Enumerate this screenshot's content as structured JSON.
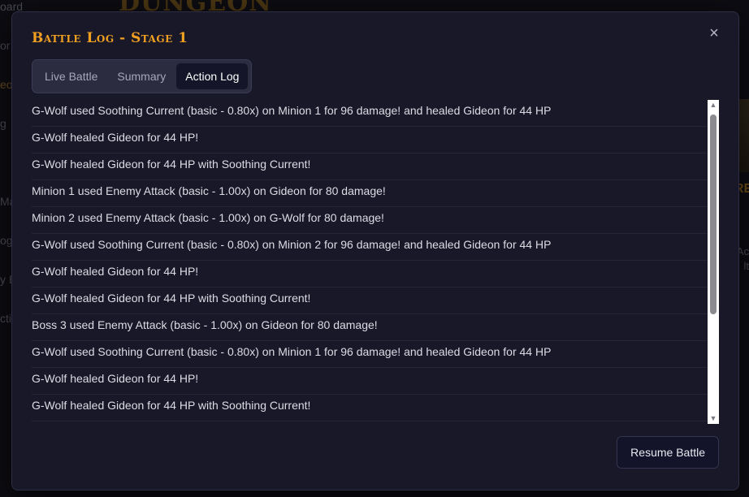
{
  "background": {
    "title": "DUNGEON",
    "sidebar_items": [
      "oard",
      "or",
      "eo",
      "g",
      "Ma",
      "og",
      "y B",
      "ctio"
    ],
    "right_texts": [
      "Ac",
      "lt"
    ],
    "right_accent": "RE"
  },
  "modal": {
    "title": "Battle Log - Stage 1",
    "close_symbol": "×",
    "tabs": [
      {
        "label": "Live Battle",
        "active": false
      },
      {
        "label": "Summary",
        "active": false
      },
      {
        "label": "Action Log",
        "active": true
      }
    ],
    "log_entries": [
      "G-Wolf used Soothing Current (basic - 0.80x) on Minion 1 for 96 damage! and healed Gideon for 44 HP",
      "G-Wolf healed Gideon for 44 HP!",
      "G-Wolf healed Gideon for 44 HP with Soothing Current!",
      "Minion 1 used Enemy Attack (basic - 1.00x) on Gideon for 80 damage!",
      "Minion 2 used Enemy Attack (basic - 1.00x) on G-Wolf for 80 damage!",
      "G-Wolf used Soothing Current (basic - 0.80x) on Minion 2 for 96 damage! and healed Gideon for 44 HP",
      "G-Wolf healed Gideon for 44 HP!",
      "G-Wolf healed Gideon for 44 HP with Soothing Current!",
      "Boss 3 used Enemy Attack (basic - 1.00x) on Gideon for 80 damage!",
      "G-Wolf used Soothing Current (basic - 0.80x) on Minion 1 for 96 damage! and healed Gideon for 44 HP",
      "G-Wolf healed Gideon for 44 HP!",
      "G-Wolf healed Gideon for 44 HP with Soothing Current!"
    ],
    "scrollbar": {
      "up_symbol": "▲",
      "down_symbol": "▼"
    },
    "resume_label": "Resume Battle"
  },
  "colors": {
    "title_accent": "#f0a020",
    "modal_bg": "#181829",
    "tab_active_bg": "#15152a"
  }
}
